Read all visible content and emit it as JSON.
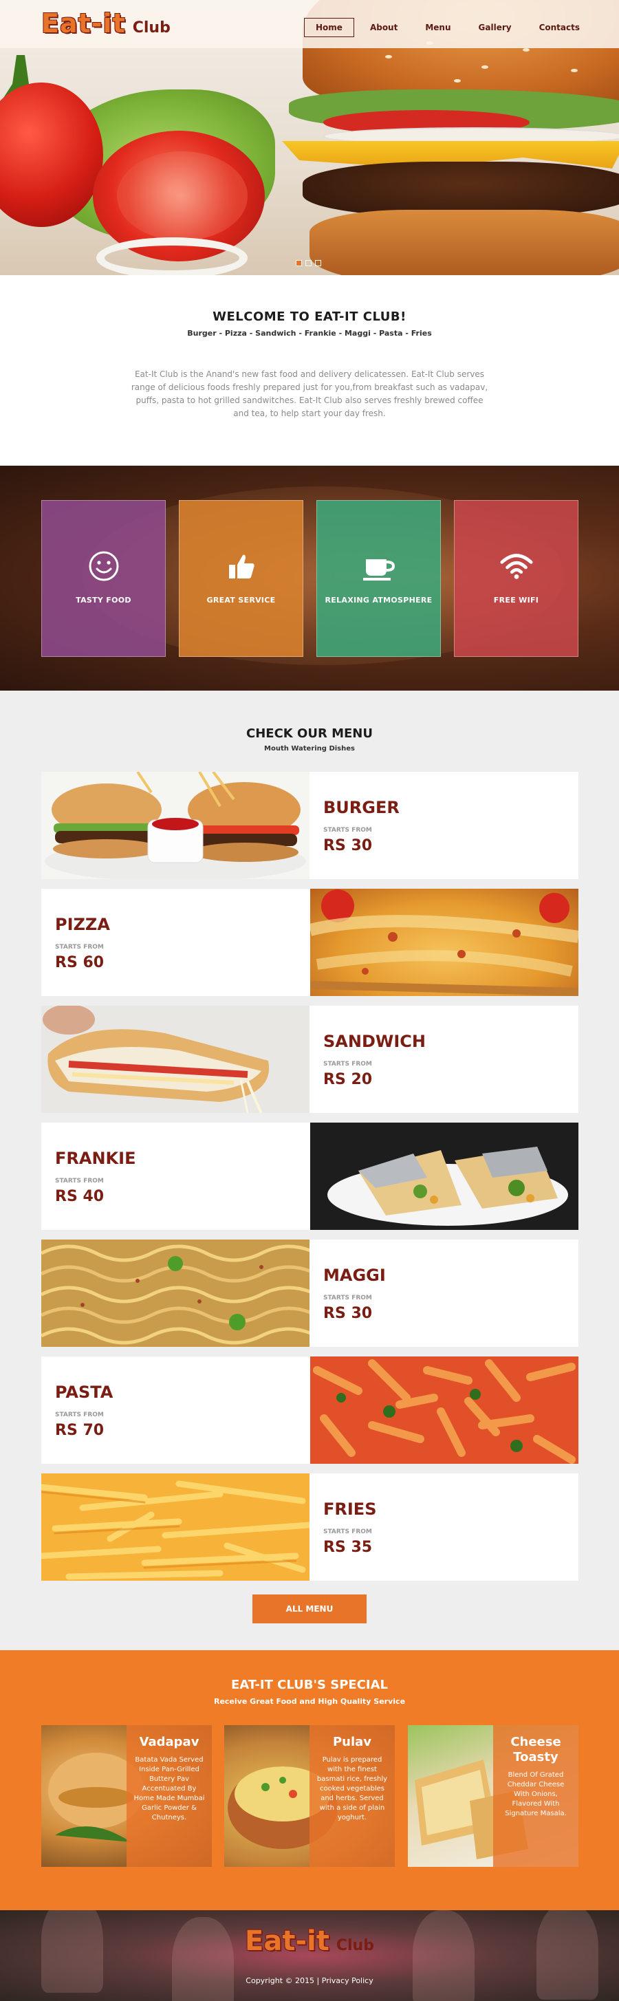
{
  "brand": {
    "logo_main": "Eat-it",
    "logo_sub": "Club"
  },
  "nav": {
    "items": [
      {
        "label": "Home",
        "active": true
      },
      {
        "label": "About",
        "active": false
      },
      {
        "label": "Menu",
        "active": false
      },
      {
        "label": "Gallery",
        "active": false
      },
      {
        "label": "Contacts",
        "active": false
      }
    ]
  },
  "slider": {
    "slides": 3,
    "current": 1
  },
  "welcome": {
    "title": "WELCOME TO EAT-IT CLUB!",
    "subtitle": "Burger - Pizza - Sandwich - Frankie - Maggi - Pasta - Fries",
    "description": "Eat-It Club is the Anand's new fast food and delivery delicatessen. Eat-It Club serves range of delicious foods freshly prepared just for you,from breakfast such as vadapav, puffs, pasta to hot grilled sandwitches. Eat-It Club also serves freshly brewed coffee and tea, to help start your day fresh."
  },
  "features": [
    {
      "label": "TASTY FOOD",
      "icon": "smiley-icon",
      "color": "#8e4a8c"
    },
    {
      "label": "GREAT SERVICE",
      "icon": "thumbs-up-icon",
      "color": "#d9822f"
    },
    {
      "label": "RELAXING ATMOSPHERE",
      "icon": "coffee-cup-icon",
      "color": "#3ea77a"
    },
    {
      "label": "FREE WIFI",
      "icon": "wifi-icon",
      "color": "#c7474a"
    }
  ],
  "menu": {
    "title": "CHECK OUR MENU",
    "subtitle": "Mouth Watering Dishes",
    "starts_from": "STARTS FROM",
    "items": [
      {
        "name": "BURGER",
        "price": "RS 30"
      },
      {
        "name": "PIZZA",
        "price": "RS 60"
      },
      {
        "name": "SANDWICH",
        "price": "RS 20"
      },
      {
        "name": "FRANKIE",
        "price": "RS 40"
      },
      {
        "name": "MAGGI",
        "price": "RS 30"
      },
      {
        "name": "PASTA",
        "price": "RS 70"
      },
      {
        "name": "FRIES",
        "price": "RS 35"
      }
    ],
    "all_menu_label": "ALL MENU"
  },
  "special": {
    "title": "EAT-IT CLUB'S SPECIAL",
    "subtitle": "Receive Great Food and High Quality Service",
    "items": [
      {
        "name": "Vadapav",
        "desc": "Batata Vada Served Inside Pan-Grilled Buttery Pav Accentuated By Home Made Mumbai Garlic Powder & Chutneys."
      },
      {
        "name": "Pulav",
        "desc": "Pulav is prepared with the finest basmati rice, freshly cooked vegetables and herbs. Served with a side of plain yoghurt."
      },
      {
        "name": "Cheese Toasty",
        "desc": "Blend Of Grated Cheddar Cheese With Onions, Flavored With Signature Masala."
      }
    ]
  },
  "footer": {
    "copyright": "Copyright © 2015",
    "separator": "|",
    "privacy": "Privacy Policy"
  },
  "colors": {
    "accent": "#e8742a",
    "brand_dark": "#7a1d12",
    "menu_bg": "#eeeeee"
  }
}
